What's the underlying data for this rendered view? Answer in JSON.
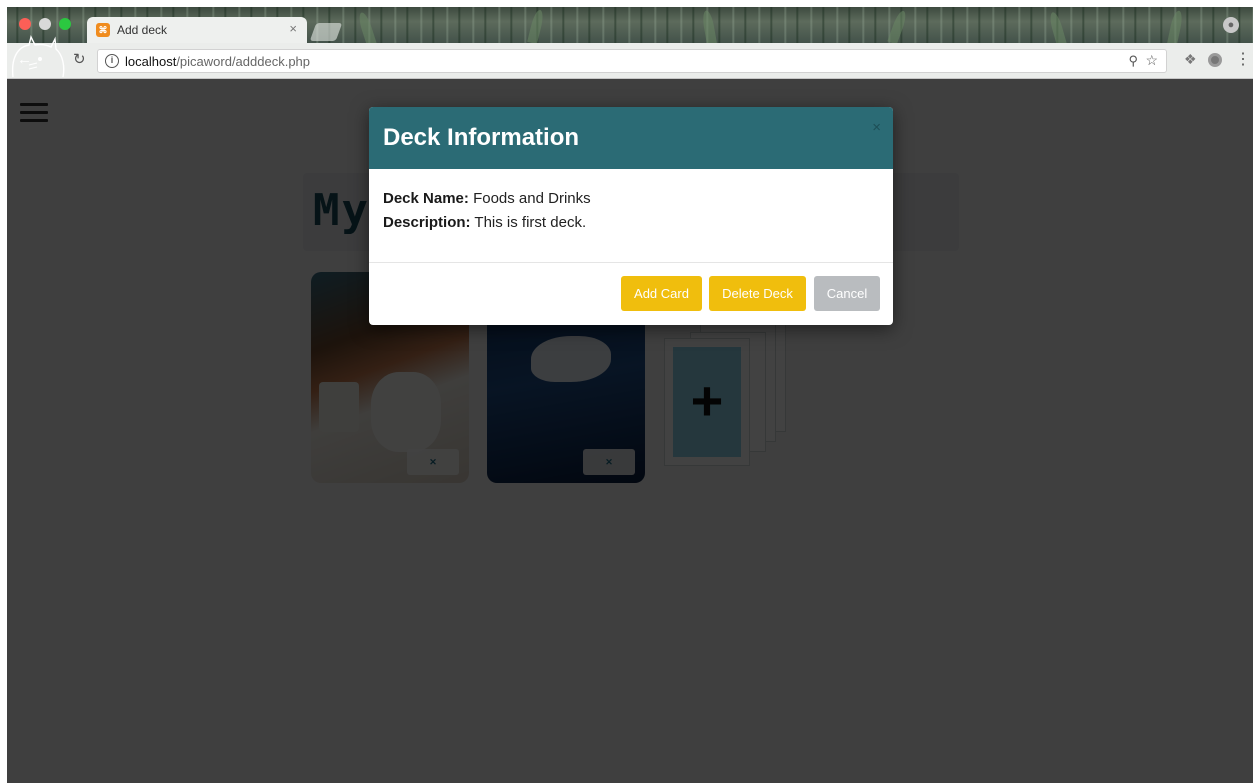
{
  "browser": {
    "tab_title": "Add deck",
    "tab_close": "×",
    "url_host": "localhost",
    "url_path": "/picaword/adddeck.php",
    "icons": [
      "back-icon",
      "reload-icon",
      "info-icon",
      "zoom-icon",
      "star-icon",
      "dropbox-icon",
      "extension-icon",
      "menu-icon",
      "profile-icon"
    ]
  },
  "page": {
    "heading": "My"
  },
  "modal": {
    "title": "Deck Information",
    "close_symbol": "×",
    "deck_name_label": "Deck Name:",
    "deck_name_value": "Foods and Drinks",
    "description_label": "Description:",
    "description_value": "This is first deck.",
    "buttons": {
      "add_card": "Add Card",
      "delete_deck": "Delete Deck",
      "cancel": "Cancel"
    }
  },
  "colors": {
    "modal_header": "#2b6b75",
    "accent_button": "#f0be0d",
    "cancel_button": "#b9bcbf",
    "overlay": "#403d35"
  }
}
